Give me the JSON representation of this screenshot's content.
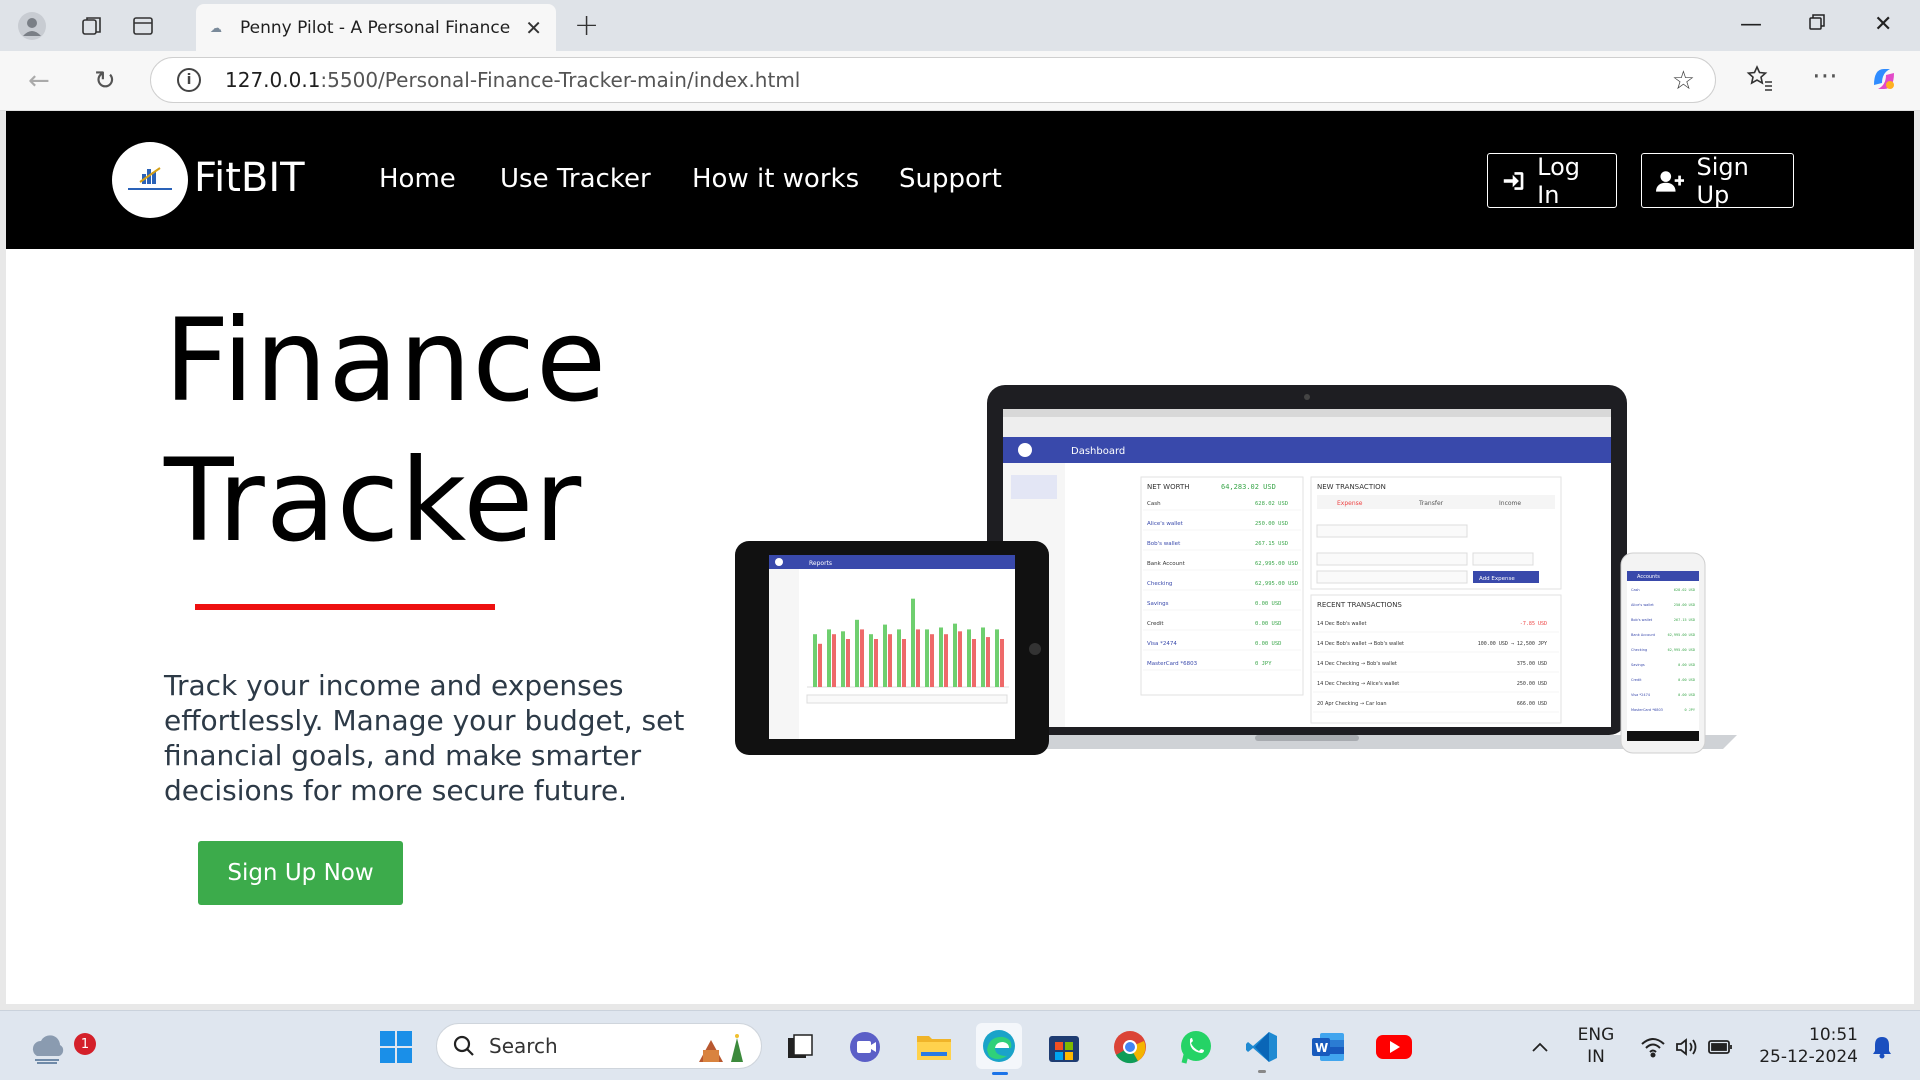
{
  "browser": {
    "tab_title": "Penny Pilot - A Personal Finance",
    "url_host": "127.0.0.1",
    "url_path": ":5500/Personal-Finance-Tracker-main/index.html"
  },
  "site": {
    "brand": "FitBIT",
    "nav": [
      "Home",
      "Use Tracker",
      "How it works",
      "Support"
    ],
    "login_label": "Log In",
    "signup_label": "Sign Up"
  },
  "hero": {
    "title_line1": "Finance",
    "title_line2": "Tracker",
    "description": "Track your income and expenses effortlessly. Manage your budget, set financial goals, and make smarter decisions for more secure future.",
    "cta_label": "Sign Up Now",
    "accent_color": "#ee1010",
    "cta_color": "#3cab4b"
  },
  "mockup": {
    "laptop_header": "Dashboard",
    "tablet_header": "Reports",
    "phone_header": "Accounts",
    "net_worth_label": "NET WORTH",
    "net_worth_value": "64,283.02 USD",
    "new_transaction_label": "NEW TRANSACTION",
    "recent_transactions_label": "RECENT TRANSACTIONS",
    "tx_tabs": [
      "Expense",
      "Transfer",
      "Income"
    ],
    "add_expense_label": "Add Expense",
    "accounts": [
      {
        "name": "Cash",
        "value": "628.02 USD"
      },
      {
        "name": "Alice's wallet",
        "value": "250.00 USD"
      },
      {
        "name": "Bob's wallet",
        "value": "267.15 USD"
      },
      {
        "name": "Bank Account",
        "value": "62,995.00 USD"
      },
      {
        "name": "Checking",
        "value": "62,995.00 USD"
      },
      {
        "name": "Savings",
        "value": "0.00 USD"
      },
      {
        "name": "Credit",
        "value": "0.00 USD"
      },
      {
        "name": "Visa *2474",
        "value": "0.00 USD"
      },
      {
        "name": "MasterCard *6803",
        "value": "0 JPY"
      }
    ],
    "transactions": [
      {
        "desc": "14 Dec  Bob's wallet",
        "amount": "-7.85 USD"
      },
      {
        "desc": "14 Dec  Bob's wallet → Bob's wallet",
        "amount": "100.00 USD → 12,500 JPY"
      },
      {
        "desc": "14 Dec  Checking → Bob's wallet",
        "amount": "375.00 USD"
      },
      {
        "desc": "14 Dec  Checking → Alice's wallet",
        "amount": "250.00 USD"
      },
      {
        "desc": "20 Apr  Checking → Car loan",
        "amount": "666.00 USD"
      }
    ],
    "chart_bars": [
      [
        0.55,
        0.45
      ],
      [
        0.6,
        0.55
      ],
      [
        0.58,
        0.5
      ],
      [
        0.7,
        0.6
      ],
      [
        0.55,
        0.5
      ],
      [
        0.65,
        0.55
      ],
      [
        0.6,
        0.5
      ],
      [
        0.92,
        0.6
      ],
      [
        0.6,
        0.55
      ],
      [
        0.62,
        0.55
      ],
      [
        0.66,
        0.58
      ],
      [
        0.6,
        0.5
      ],
      [
        0.62,
        0.52
      ],
      [
        0.6,
        0.5
      ]
    ],
    "bar_colors": [
      "#6fcf6f",
      "#ee6a6a"
    ]
  },
  "taskbar": {
    "search_placeholder": "Search",
    "lang_line1": "ENG",
    "lang_line2": "IN",
    "time": "10:51",
    "date": "25-12-2024",
    "weather_badge": "1"
  }
}
